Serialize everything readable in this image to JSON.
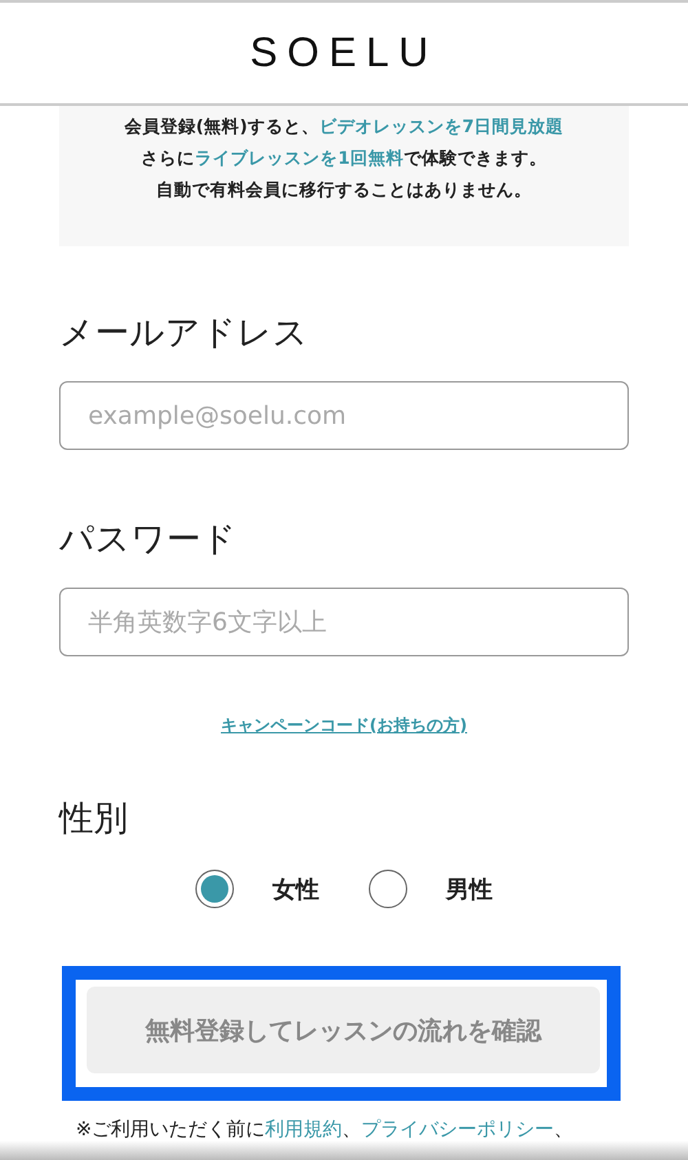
{
  "header": {
    "logo": "SOELU"
  },
  "intro": {
    "lines": [
      [
        {
          "text": "会員登録(無料)すると、",
          "kind": "plain"
        },
        {
          "text": "ビデオレッスンを7日間見放題",
          "kind": "accent"
        }
      ],
      [
        {
          "text": "さらに",
          "kind": "plain"
        },
        {
          "text": "ライブレッスンを1回無料",
          "kind": "accent"
        },
        {
          "text": "で体験できます。",
          "kind": "plain"
        }
      ],
      [
        {
          "text": "自動で有料会員に移行することはありません。",
          "kind": "plain"
        }
      ]
    ]
  },
  "fields": [
    {
      "label": "メールアドレス",
      "placeholder": "example@soelu.com"
    },
    {
      "label": "パスワード",
      "placeholder": "半角英数字6文字以上"
    }
  ],
  "campaign_link": "キャンペーンコード(お持ちの方)",
  "gender": {
    "label": "性別",
    "options": [
      {
        "label": "女性",
        "selected": true
      },
      {
        "label": "男性",
        "selected": false
      }
    ]
  },
  "submit": {
    "label": "無料登録してレッスンの流れを確認",
    "highlighted": true
  },
  "footer": [
    {
      "text": "※ご利用いただく前に",
      "kind": "plain"
    },
    {
      "text": "利用規約",
      "kind": "link"
    },
    {
      "text": "、",
      "kind": "plain"
    },
    {
      "text": "プライバシーポリシー",
      "kind": "link"
    },
    {
      "text": "、",
      "kind": "plain"
    }
  ]
}
